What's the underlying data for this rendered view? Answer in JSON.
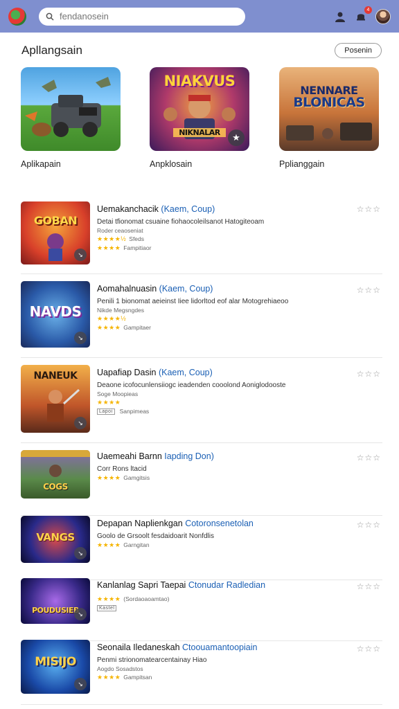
{
  "topbar": {
    "search_placeholder": "fendanosein",
    "notification_count": "4",
    "colors": {
      "bar": "#7f8fcf",
      "badge": "#e53935"
    },
    "icons": [
      "logo",
      "search-icon",
      "user-icon",
      "bell-icon",
      "avatar"
    ]
  },
  "section": {
    "title": "Apllangsain",
    "button": "Posenin"
  },
  "featured": [
    {
      "label": "Aplikapain",
      "art_text": ""
    },
    {
      "label": "Anpklosain",
      "art_text": "NIAKVUS",
      "art_sub": "NIKNALAR"
    },
    {
      "label": "Pplianggain",
      "art_text": "NENNARE",
      "art_text2": "BLONICAS"
    }
  ],
  "apps": [
    {
      "title": "Uemakanchacik",
      "link": "(Kaem, Coup)",
      "desc": "Detai tfionomat csuaine fiohaocoleilsanot Hatogiteoam",
      "sub": "Roder ceaoseniat",
      "rating": "★★★★½",
      "rating_text": "Sfeds",
      "stars2": "★★★★",
      "category": "Fampitiaor",
      "thumb_text": "GOBAN",
      "rstars": "☆☆☆"
    },
    {
      "title": "Aomahalnuasin",
      "link": "(Kaem, Coup)",
      "desc": "Penili 1 bionomat aeieinst Iiee lidorltod eof alar Motogrehiaeoo",
      "sub": "Nikde Megsngdes",
      "rating": "★★★★½",
      "rating_text": "",
      "stars2": "★★★★",
      "category": "Gampitaer",
      "thumb_text": "NAVDS",
      "rstars": "☆☆☆"
    },
    {
      "title": "Uapafiap Dasin",
      "link": "(Kaem, Coup)",
      "desc": "Deaone icofocunlensiiogc ieadenden cooolond Aoniglodooste",
      "sub": "Soge Moopieas",
      "rating": "★★★★",
      "rating_text": "",
      "stars2": "",
      "category": "Sanpimeas",
      "tag": "Lapoi",
      "thumb_text": "NANEUK",
      "rstars": "☆☆☆"
    },
    {
      "title": "Uaemeahi Barnn",
      "link": "Iapding Don)",
      "desc": "Corr Rons ltacid",
      "sub": "",
      "rating": "★★★★",
      "rating_text": "",
      "stars2": "",
      "category": "Gamgitsis",
      "thumb_text": "COGS",
      "rstars": "☆☆☆"
    },
    {
      "title": "Depapan Naplienkgan",
      "link": "Cotoronsenetolan",
      "desc": "Goolo de Grsoolt fesdaidoarit Nonfdlis",
      "sub": "",
      "rating": "★★★★",
      "rating_text": "",
      "stars2": "",
      "category": "Garngitan",
      "thumb_text": "VANGS",
      "rstars": "☆☆☆"
    },
    {
      "title": "Kanlanlag Sapri Taepai",
      "link": "Ctonudar Radledian",
      "desc": "",
      "sub": "",
      "rating": "★★★★",
      "rating_text": "(Sordaoaoamtao)",
      "stars2": "",
      "category": "",
      "tag": "Kastel",
      "thumb_text": "POUDUSIEB",
      "rstars": "☆☆☆"
    },
    {
      "title": "Seonaila Iledaneskah",
      "link": "Ctoouamantoopiain",
      "desc": "Penmi strionomatearcentainay Hiao",
      "sub": "Aogdo Sosadstos",
      "rating": "★★★★",
      "rating_text": "",
      "stars2": "",
      "category": "Gampitsan",
      "thumb_text": "MISIJO",
      "rstars": "☆☆☆"
    }
  ]
}
